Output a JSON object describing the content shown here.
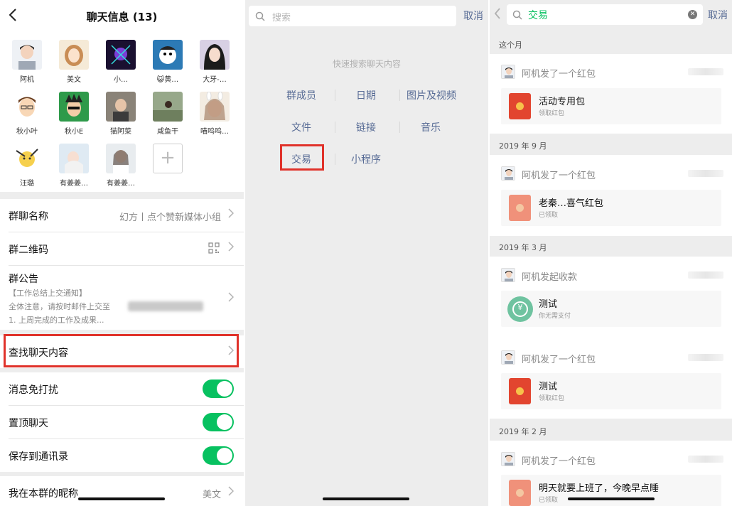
{
  "panel1": {
    "title": "聊天信息 (13)",
    "members": [
      {
        "name": "阿机"
      },
      {
        "name": "美文"
      },
      {
        "name": "小…"
      },
      {
        "name": "😺黄…"
      },
      {
        "name": "大牙-…"
      },
      {
        "name": "秋小叶"
      },
      {
        "name": "秋小E"
      },
      {
        "name": "猫阿菜"
      },
      {
        "name": "咸鱼干"
      },
      {
        "name": "喵呜呜…"
      },
      {
        "name": "汪璐"
      },
      {
        "name": "有姜姜…"
      },
      {
        "name": "有姜姜…"
      }
    ],
    "add_label": "+",
    "group_name_label": "群聊名称",
    "group_name_value": "幻方丨点个赞新媒体小组",
    "qr_label": "群二维码",
    "notice_label": "群公告",
    "notice_line1": "【工作总结上交通知】",
    "notice_line2": "全体注意，请按时邮件上交至",
    "notice_line3": "1. 上周完成的工作及成果...",
    "search_chat_label": "查找聊天内容",
    "mute_label": "消息免打扰",
    "pin_label": "置顶聊天",
    "save_label": "保存到通讯录",
    "nickname_label": "我在本群的昵称",
    "nickname_value": "美文"
  },
  "panel2": {
    "search_placeholder": "搜索",
    "cancel": "取消",
    "quick_title": "快速搜索聊天内容",
    "categories": [
      "群成员",
      "日期",
      "图片及视频",
      "文件",
      "链接",
      "音乐",
      "交易",
      "小程序"
    ]
  },
  "panel3": {
    "search_value": "交易",
    "cancel": "取消",
    "months": [
      "这个月",
      "2019 年 9 月",
      "2019 年 3 月",
      "2019 年 2 月"
    ],
    "items": [
      {
        "sender": "阿机发了一个红包",
        "title": "活动专用包",
        "sub": "领取红包"
      },
      {
        "sender": "阿机发了一个红包",
        "title": "老秦…喜气红包",
        "sub": "已领取"
      },
      {
        "sender": "阿机发起收款",
        "title": "测试",
        "sub": "你无需支付"
      },
      {
        "sender": "阿机发了一个红包",
        "title": "测试",
        "sub": "领取红包"
      },
      {
        "sender": "阿机发了一个红包",
        "title": "明天就要上班了，今晚早点睡",
        "sub": "已领取"
      }
    ]
  },
  "colors": {
    "accent_green": "#07c160",
    "link_blue": "#576b95",
    "highlight_red": "#e0322a",
    "red_packet": "#e2452f"
  }
}
